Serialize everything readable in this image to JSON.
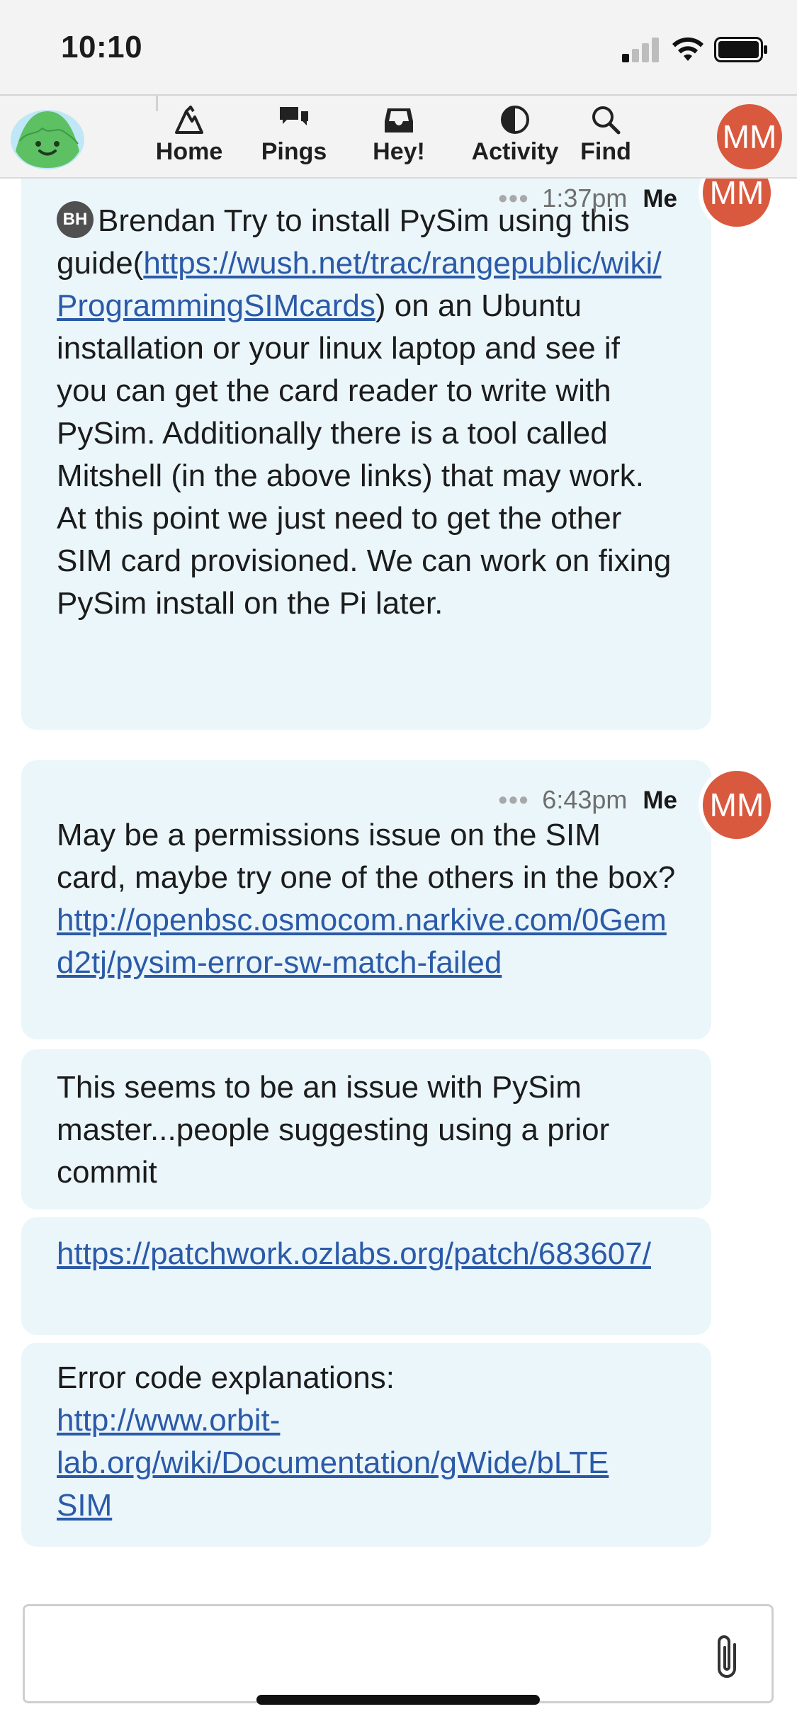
{
  "status_bar": {
    "time": "10:10"
  },
  "nav": {
    "items": [
      {
        "label": "Home",
        "icon": "home-icon"
      },
      {
        "label": "Pings",
        "icon": "pings-icon"
      },
      {
        "label": "Hey!",
        "icon": "inbox-icon"
      },
      {
        "label": "Activity",
        "icon": "activity-icon"
      },
      {
        "label": "Find",
        "icon": "search-icon"
      }
    ],
    "avatar_initials": "MM"
  },
  "messages": [
    {
      "time": "1:37pm",
      "author": "Me",
      "avatar_initials": "MM",
      "mention_initials": "BH",
      "mention_name": "Brendan",
      "text_before": " Try to install PySim using this guide(",
      "link": "https://wush.net/trac/rangepublic/wiki/ProgrammingSIMcards",
      "text_after": ") on an Ubuntu installation or your linux laptop and see if you can get the card reader to write with PySim. Additionally there is a tool called Mitshell (in the above links) that may work. At this point we just need to get the other SIM card provisioned. We can work on fixing PySim install on the Pi later."
    },
    {
      "time": "6:43pm",
      "author": "Me",
      "avatar_initials": "MM",
      "text": "May be a permissions issue on the SIM card, maybe try one of the others in the box?",
      "link": "http://openbsc.osmocom.narkive.com/0Gemd2tj/pysim-error-sw-match-failed"
    },
    {
      "text": "This seems to be an issue with PySim master...people suggesting using a prior commit"
    },
    {
      "link": "https://patchwork.ozlabs.org/patch/683607/"
    },
    {
      "text": "Error code explanations:",
      "link_line1": "http://www.orbit-",
      "link_line2": "lab.org/wiki/Documentation/gWide/bLTE",
      "link_line3": "SIM"
    }
  ],
  "colors": {
    "accent": "#d9593e",
    "bubble": "#ebf6fb",
    "link": "#2b5aa8"
  }
}
